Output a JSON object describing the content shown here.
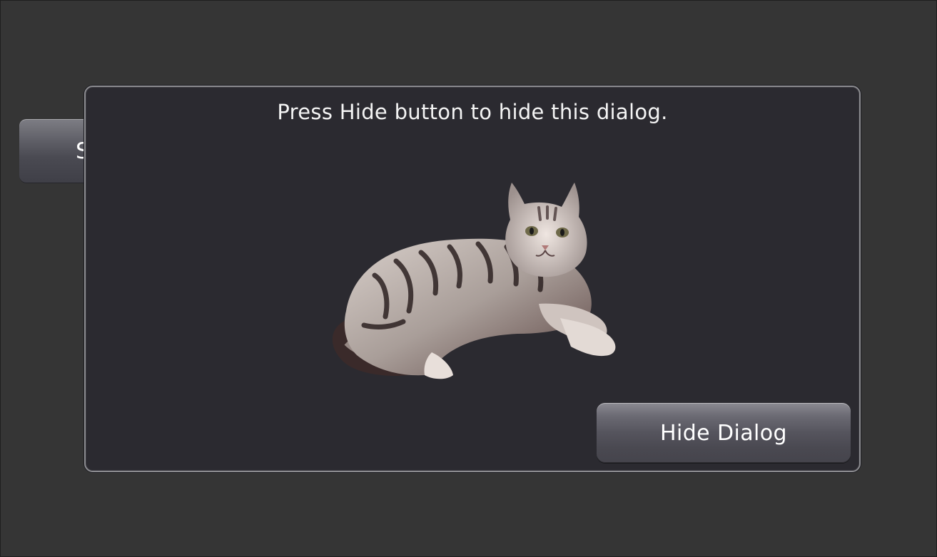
{
  "background_button": {
    "label": "S"
  },
  "dialog": {
    "message": "Press Hide button to hide this dialog.",
    "image": "cat-photo",
    "hide_button_label": "Hide Dialog"
  }
}
